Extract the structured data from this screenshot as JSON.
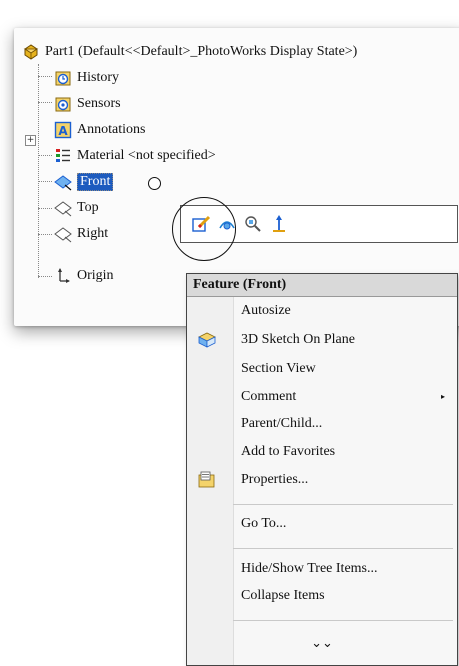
{
  "tree": {
    "root": "Part1  (Default<<Default>_PhotoWorks Display State>)",
    "items": [
      {
        "label": "History",
        "icon": "history-icon"
      },
      {
        "label": "Sensors",
        "icon": "sensors-icon"
      },
      {
        "label": "Annotations",
        "icon": "annotations-icon",
        "expander": "+"
      },
      {
        "label": "Material <not specified>",
        "icon": "material-icon"
      },
      {
        "label": "Front",
        "icon": "plane-icon",
        "selected": true
      },
      {
        "label": "Top",
        "icon": "plane-icon"
      },
      {
        "label": "Right",
        "icon": "plane-icon"
      },
      {
        "label": "Origin",
        "icon": "origin-icon"
      }
    ]
  },
  "context_toolbar": {
    "buttons": [
      "edit-sketch-icon",
      "show-hide-icon",
      "zoom-to-selection-icon",
      "normal-to-icon"
    ]
  },
  "context_menu": {
    "title": "Feature (Front)",
    "items": [
      {
        "label": "Autosize"
      },
      {
        "label": "3D Sketch On Plane",
        "icon": "3d-sketch-icon"
      },
      {
        "label": "Section View"
      },
      {
        "label": "Comment",
        "submenu": "▸"
      },
      {
        "label": "Parent/Child..."
      },
      {
        "label": "Add to Favorites"
      },
      {
        "label": "Properties...",
        "icon": "properties-icon"
      },
      {
        "label": "Go To..."
      },
      {
        "label": "Hide/Show Tree Items..."
      },
      {
        "label": "Collapse Items"
      }
    ],
    "more": "⌄⌄"
  },
  "colors": {
    "selection": "#1d5bbf",
    "menu_header": "#d9d9d9"
  }
}
